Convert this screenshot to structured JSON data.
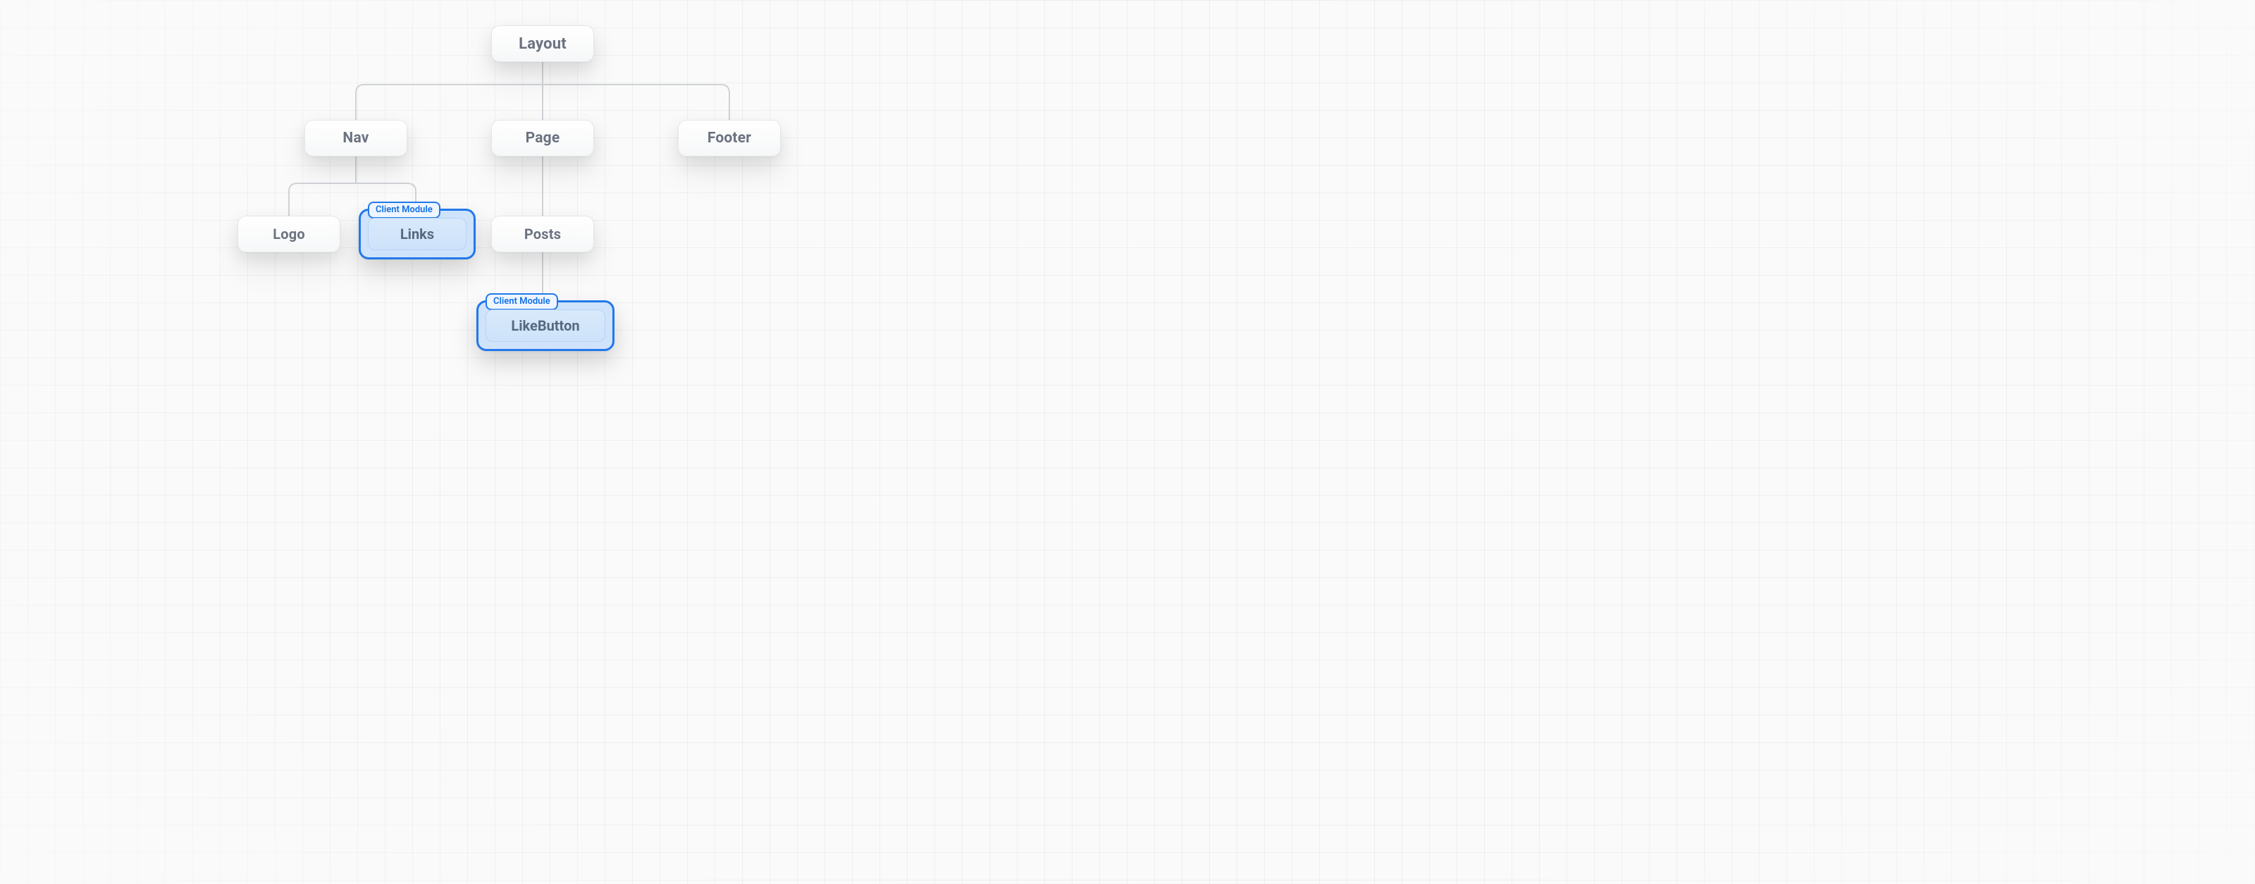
{
  "diagram": {
    "root": {
      "label": "Layout"
    },
    "nav": {
      "label": "Nav"
    },
    "page": {
      "label": "Page"
    },
    "footer": {
      "label": "Footer"
    },
    "logo": {
      "label": "Logo"
    },
    "links": {
      "label": "Links",
      "tag": "Client Module"
    },
    "posts": {
      "label": "Posts"
    },
    "likebutton": {
      "label": "LikeButton",
      "tag": "Client Module"
    }
  }
}
